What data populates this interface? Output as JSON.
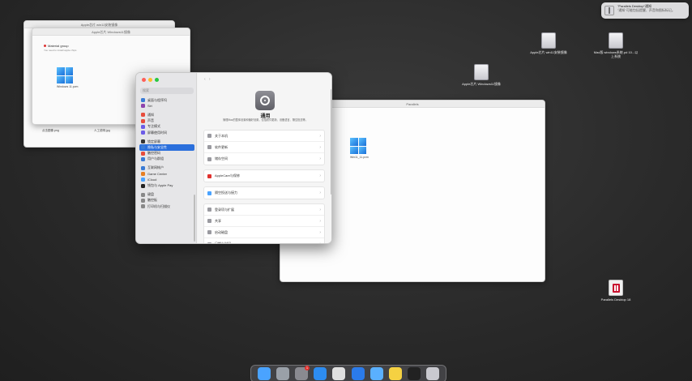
{
  "notification": {
    "title": "\"Parallels Desktop\"通知",
    "body": "\"通知\"可能包括提醒、声音和图标标记。"
  },
  "desktop": {
    "icons": [
      {
        "label": "Apple芯片 win11安装镜像",
        "kind": "drive"
      },
      {
        "label": "Mac版 windows系统.pd 10...以上系统",
        "kind": "drive"
      },
      {
        "label": "Apple芯片 Windows11镜像",
        "kind": "drive"
      },
      {
        "label": "Parallels Desktop 18",
        "kind": "parallels"
      }
    ]
  },
  "windows": {
    "back": {
      "title": "Apple芯片 win11安装镜像"
    },
    "middle": {
      "title": "Apple芯片 Windows11镜像",
      "group_title": "Material group",
      "group_sub": "You need to install apple chips",
      "file_label": "Windows 11.pvm",
      "item1": "点击图像.png",
      "item2": "人工说明.jpg"
    },
    "parallels": {
      "title": "Parallels",
      "file_label": "Win11_11.pvm"
    }
  },
  "settings": {
    "search_placeholder": "搜索",
    "sidebar": [
      {
        "label": "桌面与程序坞",
        "color": "#3a7bd5"
      },
      {
        "label": "Siri",
        "color": "#8e44ad"
      },
      {
        "label": "",
        "color": ""
      },
      {
        "label": "通知",
        "color": "#e74c3c"
      },
      {
        "label": "声音",
        "color": "#e74c3c"
      },
      {
        "label": "专注模式",
        "color": "#6c5ce7"
      },
      {
        "label": "屏幕使用时间",
        "color": "#6c5ce7"
      },
      {
        "label": "",
        "color": ""
      },
      {
        "label": "锁定屏幕",
        "color": "#333333"
      },
      {
        "label": "隐私与安全性",
        "color": "#3a7bd5",
        "active": true
      },
      {
        "label": "触控密码",
        "color": "#e74c3c"
      },
      {
        "label": "用户与群组",
        "color": "#3a7bd5"
      },
      {
        "label": "",
        "color": ""
      },
      {
        "label": "互联网帐户",
        "color": "#3a7bd5"
      },
      {
        "label": "Game Center",
        "color": "#e67e22"
      },
      {
        "label": "iCloud",
        "color": "#4aa3ff"
      },
      {
        "label": "钱包与 Apple Pay",
        "color": "#222222"
      },
      {
        "label": "",
        "color": ""
      },
      {
        "label": "键盘",
        "color": "#888888"
      },
      {
        "label": "触控板",
        "color": "#888888"
      },
      {
        "label": "打印机与扫描仪",
        "color": "#888888"
      }
    ],
    "content": {
      "title": "通用",
      "description": "管理Mac的整体设置和偏好设置，包括软件更新、设备语言、隔空投送等。",
      "groups": [
        [
          "关于本机",
          "软件更新",
          "储存空间"
        ],
        [
          "AppleCare与保修"
        ],
        [
          "隔空投送与接力"
        ],
        [
          "登录项与扩展",
          "共享",
          "启动磁盘",
          "日期与时间"
        ]
      ]
    }
  },
  "dock": {
    "apps": [
      {
        "name": "finder-icon",
        "color": "#4aa3ff"
      },
      {
        "name": "launchpad-icon",
        "color": "#9aa0a8"
      },
      {
        "name": "system-settings-icon",
        "color": "#8a8a90",
        "badge": "1"
      },
      {
        "name": "safari-icon",
        "color": "#2d8cf0"
      },
      {
        "name": "chrome-icon",
        "color": "#e0e0e0"
      },
      {
        "name": "app-store-icon",
        "color": "#2b7bea"
      },
      {
        "name": "parallels-icon",
        "color": "#5ab0ff"
      },
      {
        "name": "notes-icon",
        "color": "#f5d142"
      },
      {
        "name": "terminal-icon",
        "color": "#222222"
      },
      {
        "name": "trash-icon",
        "color": "#c9c9cf"
      }
    ]
  }
}
